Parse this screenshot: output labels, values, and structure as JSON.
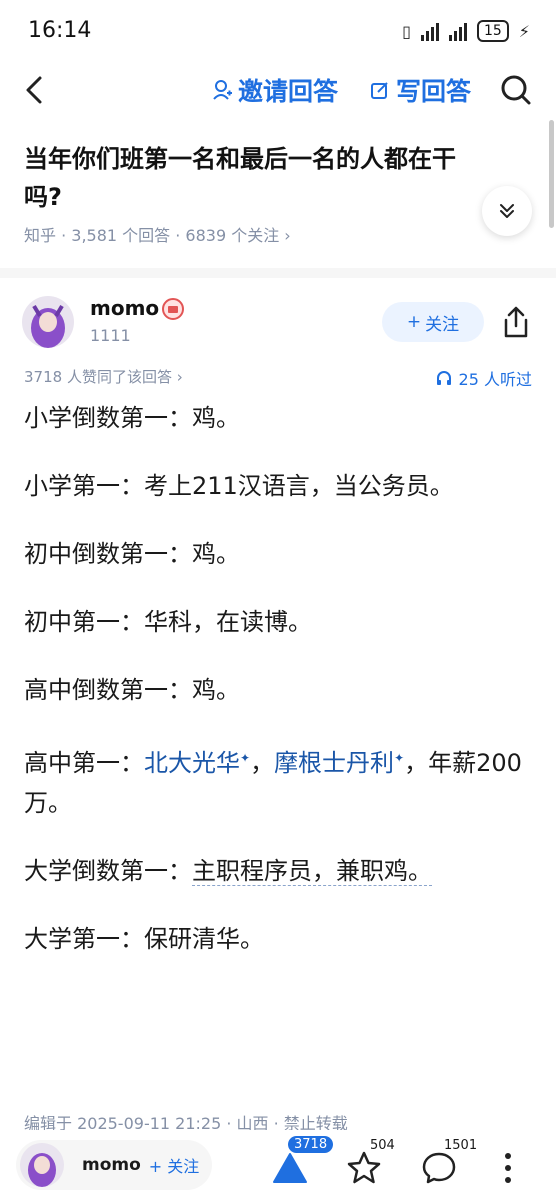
{
  "status_bar": {
    "time": "16:14",
    "battery": "15"
  },
  "nav": {
    "invite_label": "邀请回答",
    "write_label": "写回答"
  },
  "question": {
    "title": "当年你们班第一名和最后一名的人都在干吗?",
    "meta": "知乎 · 3,581 个回答 · 6839 个关注 ›"
  },
  "author": {
    "name": "momo",
    "bio": "1111",
    "follow_label": "关注"
  },
  "stats": {
    "votes_text": "3718 人赞同了该回答 ›",
    "listen_text": "25 人听过"
  },
  "answer": {
    "lines": [
      "小学倒数第一：鸡。",
      "小学第一：考上211汉语言，当公务员。",
      "初中倒数第一：鸡。",
      "初中第一：华科，在读博。",
      "高中倒数第一：鸡。"
    ],
    "line6_prefix": "高中第一：",
    "line6_link1": "北大光华",
    "line6_sep": "，",
    "line6_link2": "摩根士丹利",
    "line6_suffix": "，年薪200万。",
    "line7_prefix": "大学倒数第一：",
    "line7_rest": "主职程序员，兼职鸡。",
    "line8": "大学第一：保研清华。"
  },
  "edit_info": "编辑于 2025-09-11 21:25 · 山西 · 禁止转载",
  "bottom_bar": {
    "name": "momo",
    "follow_label": "关注",
    "vote_count": "3718",
    "like_count": "504",
    "comment_count": "1501"
  },
  "colors": {
    "accent": "#1f6fe0",
    "link": "#1a56a8",
    "meta_gray": "#8590a6"
  },
  "icons": [
    "back-arrow-icon",
    "invite-user-icon",
    "edit-icon",
    "search-icon",
    "chevron-double-down-icon",
    "badge-icon",
    "plus-icon",
    "share-icon",
    "headphones-icon",
    "upvote-icon",
    "star-icon",
    "comment-icon",
    "more-vertical-icon"
  ]
}
